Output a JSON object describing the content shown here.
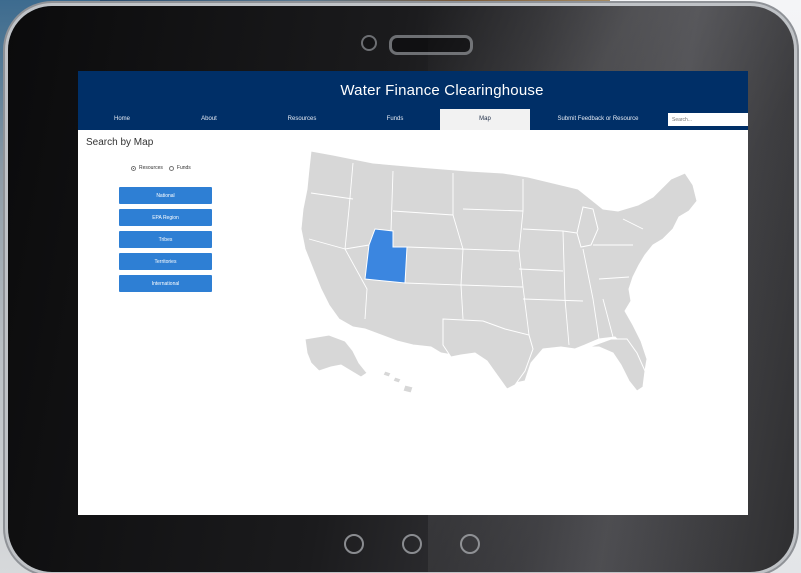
{
  "site": {
    "title": "Water Finance Clearinghouse"
  },
  "nav": {
    "items": [
      {
        "label": "Home",
        "active": false
      },
      {
        "label": "About",
        "active": false
      },
      {
        "label": "Resources",
        "active": false
      },
      {
        "label": "Funds",
        "active": false
      },
      {
        "label": "Map",
        "active": true
      },
      {
        "label": "Submit Feedback or Resource",
        "active": false
      }
    ],
    "search_placeholder": "Search..."
  },
  "page": {
    "title": "Search by Map",
    "radios": [
      {
        "label": "Resources",
        "checked": true
      },
      {
        "label": "Funds",
        "checked": false
      }
    ],
    "buttons": [
      "National",
      "EPA Region",
      "Tribes",
      "Territories",
      "International"
    ]
  },
  "map": {
    "highlighted_state": "Utah",
    "state_fill": "#d7d7d7",
    "highlight_fill": "#3b86e0",
    "border_color": "#ffffff"
  },
  "colors": {
    "header_bg": "#002f67",
    "button_bg": "#2e7fd4",
    "active_tab_bg": "#f2f2f2"
  }
}
